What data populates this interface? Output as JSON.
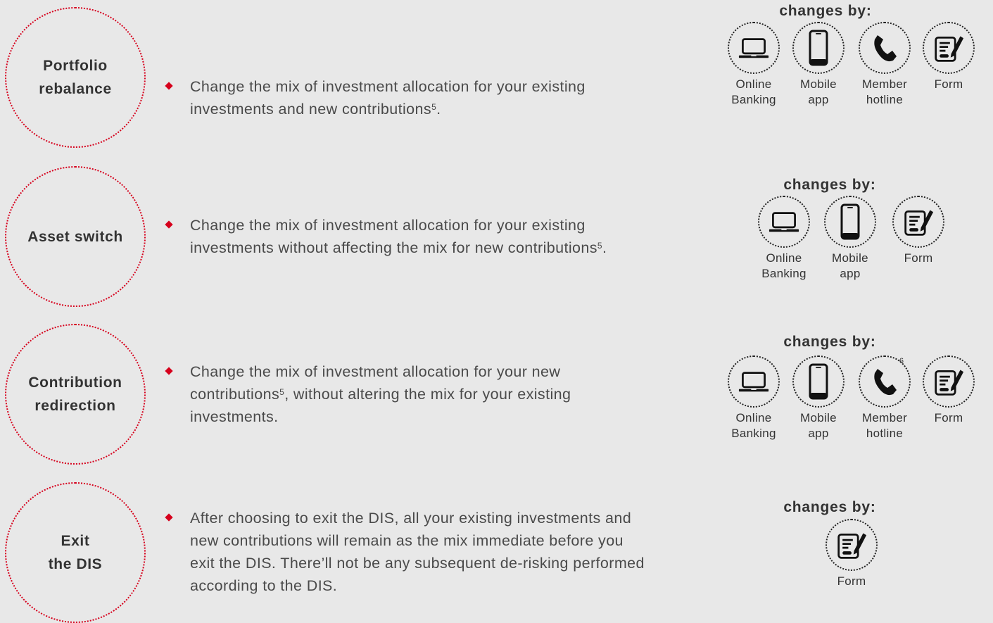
{
  "rows": [
    {
      "name": "portfolio-rebalance",
      "title_lines": [
        "Portfolio",
        "rebalance"
      ],
      "text_lines": [
        "Change the mix of investment allocation for your existing",
        "investments and new contributions"
      ],
      "footnote": "5",
      "tail": ".",
      "changes_by": "changes by:",
      "channels": [
        {
          "icon": "laptop-icon",
          "label_lines": [
            "Online",
            "Banking"
          ]
        },
        {
          "icon": "mobile-phone-icon",
          "label_lines": [
            "Mobile",
            "app"
          ]
        },
        {
          "icon": "phone-handset-icon",
          "label_lines": [
            "Member",
            "hotline"
          ]
        },
        {
          "icon": "form-pen-icon",
          "label_lines": [
            "Form"
          ]
        }
      ]
    },
    {
      "name": "asset-switch",
      "title_lines": [
        "Asset switch"
      ],
      "text_lines": [
        "Change the mix of investment allocation for your existing",
        "investments without affecting the mix for new contributions"
      ],
      "footnote": "5",
      "tail": ".",
      "changes_by": "changes by:",
      "channels": [
        {
          "icon": "laptop-icon",
          "label_lines": [
            "Online",
            "Banking"
          ]
        },
        {
          "icon": "mobile-phone-icon",
          "label_lines": [
            "Mobile",
            "app"
          ]
        },
        {
          "icon": "form-pen-icon",
          "label_lines": [
            "Form"
          ]
        }
      ]
    },
    {
      "name": "contribution-redirection",
      "title_lines": [
        "Contribution",
        "redirection"
      ],
      "text_lines": [
        "Change the mix of investment allocation for your new",
        "contributions",
        ", without altering the mix for your existing",
        "investments."
      ],
      "footnote": "5",
      "changes_by": "changes by:",
      "hotline_footnote": "6",
      "channels": [
        {
          "icon": "laptop-icon",
          "label_lines": [
            "Online",
            "Banking"
          ]
        },
        {
          "icon": "mobile-phone-icon",
          "label_lines": [
            "Mobile",
            "app"
          ]
        },
        {
          "icon": "phone-handset-icon",
          "label_lines": [
            "Member",
            "hotline"
          ]
        },
        {
          "icon": "form-pen-icon",
          "label_lines": [
            "Form"
          ]
        }
      ]
    },
    {
      "name": "exit-the-dis",
      "title_lines": [
        "Exit",
        "the DIS"
      ],
      "text_lines": [
        "After choosing to exit the DIS, all your existing investments and",
        "new contributions will remain as the mix immediate before you",
        "exit the DIS. There’ll not be any subsequent de-risking performed",
        "according to the DIS."
      ],
      "changes_by": "changes by:",
      "channels": [
        {
          "icon": "form-pen-icon",
          "label_lines": [
            "Form"
          ]
        }
      ]
    }
  ]
}
